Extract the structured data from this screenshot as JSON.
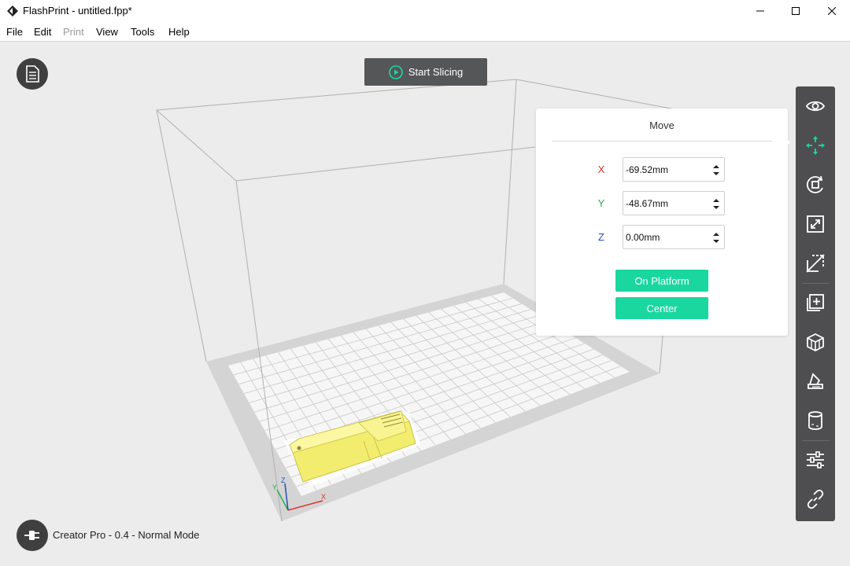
{
  "window": {
    "title": "FlashPrint - untitled.fpp*"
  },
  "menu": {
    "items": [
      "File",
      "Edit",
      "Print",
      "View",
      "Tools",
      "Help"
    ]
  },
  "toolbar_top": {
    "slice_label": "Start Slicing"
  },
  "move_panel": {
    "title": "Move",
    "x_label": "X",
    "y_label": "Y",
    "z_label": "Z",
    "x_value": "-69.52mm",
    "y_value": "-48.67mm",
    "z_value": "0.00mm",
    "on_platform_label": "On Platform",
    "center_label": "Center"
  },
  "scene": {
    "axis_x": "X",
    "axis_y": "Y",
    "axis_z": "Z"
  },
  "status": {
    "text": "Creator Pro - 0.4 - Normal Mode"
  },
  "right_tools": [
    "view-icon",
    "move-icon",
    "rotate-icon",
    "scale-icon",
    "cut-icon",
    "add-model-icon",
    "support-icon",
    "extruder-icon",
    "raft-icon",
    "settings-sliders-icon",
    "connect-icon"
  ],
  "colors": {
    "accent": "#1ad7a0",
    "axis_x": "#e0302a",
    "axis_y": "#2fa84a",
    "axis_z": "#2250b8",
    "model": "#f5f087",
    "toolbar": "#4e4e50"
  }
}
